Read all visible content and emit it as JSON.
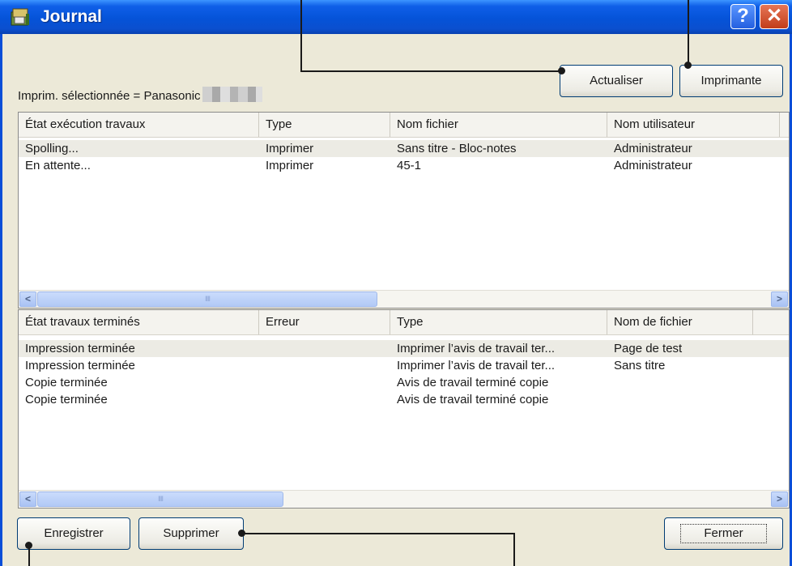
{
  "window": {
    "title": "Journal",
    "help_glyph": "?",
    "close_glyph": "✕"
  },
  "toolbar": {
    "selected_printer_label": "Imprim. sélectionnée = Panasonic",
    "refresh_label": "Actualiser",
    "printer_label": "Imprimante"
  },
  "current_jobs": {
    "headers": [
      "État exécution travaux",
      "Type",
      "Nom fichier",
      "Nom utilisateur"
    ],
    "rows": [
      [
        "Spolling...",
        "Imprimer",
        "Sans titre - Bloc-notes",
        "Administrateur"
      ],
      [
        "En attente...",
        "Imprimer",
        "45-1",
        "Administrateur"
      ]
    ]
  },
  "completed_jobs": {
    "headers": [
      "État travaux terminés",
      "Erreur",
      "Type",
      "Nom de fichier"
    ],
    "rows": [
      [
        "Impression terminée",
        "",
        "Imprimer l’avis de travail ter...",
        "Page de test"
      ],
      [
        "Impression terminée",
        "",
        "Imprimer l’avis de travail ter...",
        "Sans titre"
      ],
      [
        "Copie terminée",
        "",
        "Avis de travail terminé copie",
        ""
      ],
      [
        "Copie terminée",
        "",
        "Avis de travail terminé copie",
        ""
      ]
    ]
  },
  "scrollbar": {
    "left_arrow": "<",
    "right_arrow": ">",
    "grip": "IIII"
  },
  "footer": {
    "save_label": "Enregistrer",
    "delete_label": "Supprimer",
    "close_label": "Fermer"
  },
  "colors": {
    "titlebar": "#0553d8",
    "face": "#ece9d8",
    "button_border": "#003c74"
  }
}
